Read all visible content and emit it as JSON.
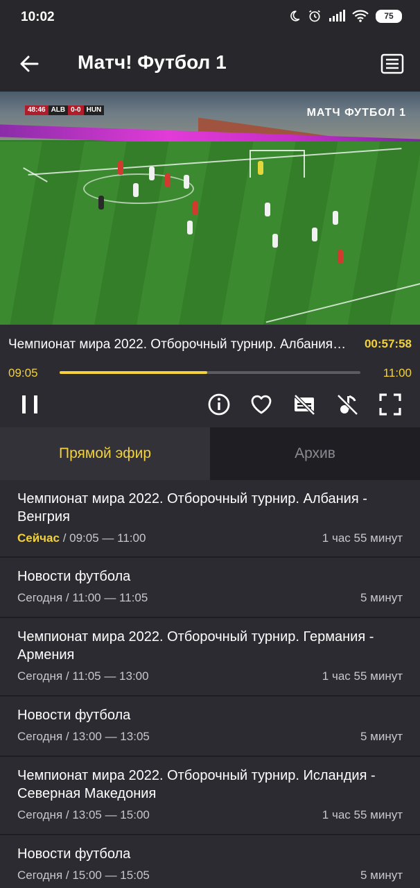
{
  "status": {
    "time": "10:02",
    "battery": "75"
  },
  "appbar": {
    "title": "Матч! Футбол 1"
  },
  "video": {
    "clock": "48:46",
    "home": "ALB",
    "score": "0-0",
    "away": "HUN",
    "channel_logo": "МАТЧ ФУТБОЛ 1"
  },
  "now": {
    "title": "Чемпионат мира 2022. Отборочный турнир. Албания - Венгрия",
    "elapsed": "00:57:58",
    "start": "09:05",
    "end": "11:00",
    "progress": 0.49
  },
  "tabs": {
    "live": "Прямой эфир",
    "archive": "Архив"
  },
  "schedule": [
    {
      "title": "Чемпионат мира 2022. Отборочный турнир. Албания - Венгрия",
      "now_label": "Сейчас",
      "time": " / 09:05 — 11:00",
      "duration": "1 час 55 минут"
    },
    {
      "title": "Новости футбола",
      "time": "Сегодня / 11:00 — 11:05",
      "duration": "5 минут"
    },
    {
      "title": "Чемпионат мира 2022. Отборочный турнир. Германия - Армения",
      "time": "Сегодня / 11:05 — 13:00",
      "duration": "1 час 55 минут"
    },
    {
      "title": "Новости футбола",
      "time": "Сегодня / 13:00 — 13:05",
      "duration": "5 минут"
    },
    {
      "title": "Чемпионат мира 2022. Отборочный турнир. Исландия - Северная Македония",
      "time": "Сегодня / 13:05 — 15:00",
      "duration": "1 час 55 минут"
    },
    {
      "title": "Новости футбола",
      "time": "Сегодня / 15:00 — 15:05",
      "duration": "5 минут"
    }
  ],
  "colors": {
    "accent": "#f4d23c",
    "background": "#2b2b31",
    "bar": "#27272c"
  },
  "icons": [
    "moon-icon",
    "alarm-icon",
    "signal-icon",
    "wifi-icon",
    "back-arrow-icon",
    "program-guide-icon",
    "pause-icon",
    "info-icon",
    "heart-icon",
    "subtitles-off-icon",
    "audio-off-icon",
    "fullscreen-icon"
  ]
}
